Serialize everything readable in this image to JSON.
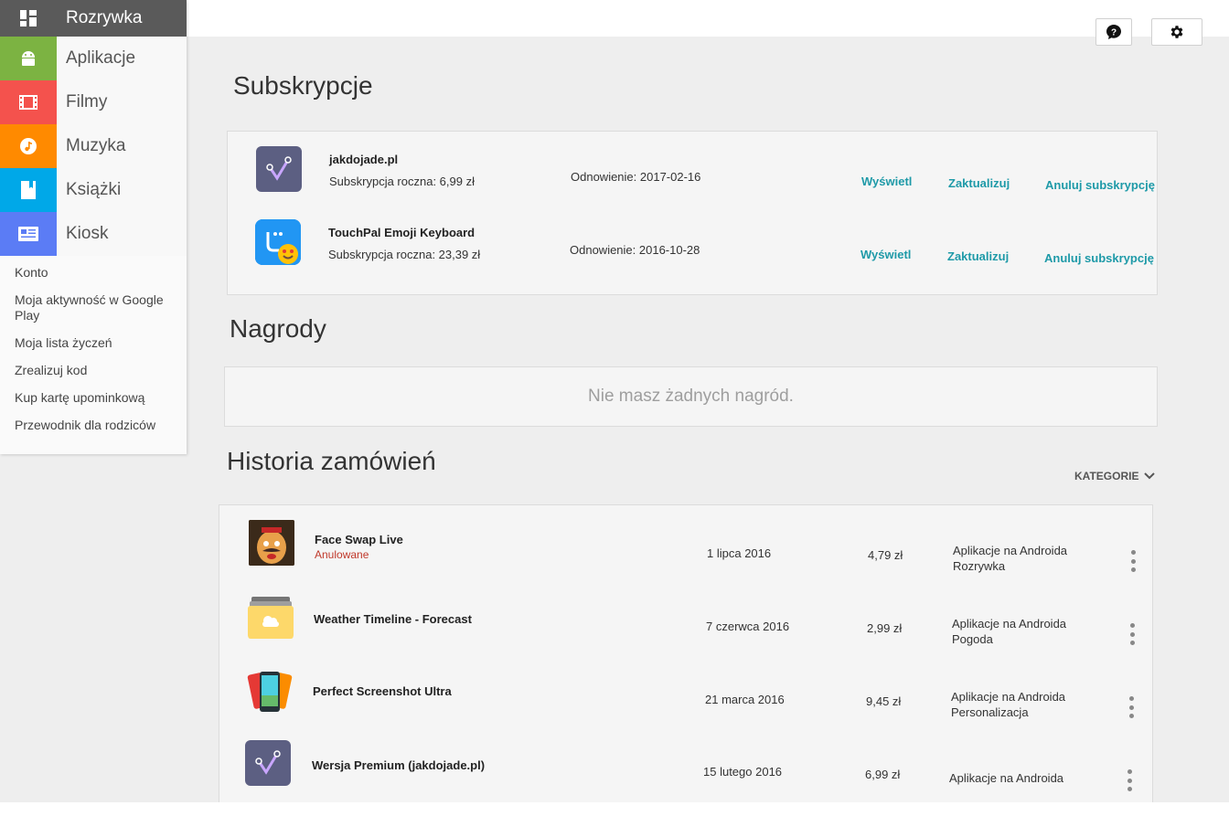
{
  "sidebar": {
    "items": [
      {
        "label": "Rozrywka",
        "color": "#5a5a5a",
        "icon": "grid-icon"
      },
      {
        "label": "Aplikacje",
        "color": "#7cb342",
        "icon": "android-icon"
      },
      {
        "label": "Filmy",
        "color": "#f4524d",
        "icon": "film-icon"
      },
      {
        "label": "Muzyka",
        "color": "#ff8a00",
        "icon": "music-icon"
      },
      {
        "label": "Książki",
        "color": "#00a8e8",
        "icon": "book-icon"
      },
      {
        "label": "Kiosk",
        "color": "#5b7cf5",
        "icon": "newsstand-icon"
      }
    ],
    "links": [
      "Konto",
      "Moja aktywność w Google Play",
      "Moja lista życzeń",
      "Zrealizuj kod",
      "Kup kartę upominkową",
      "Przewodnik dla rodziców"
    ]
  },
  "subscriptions": {
    "heading": "Subskrypcje",
    "rows": [
      {
        "name": "jakdojade.pl",
        "plan": "Subskrypcja roczna: 6,99 zł",
        "renewal": "Odnowienie: 2017-02-16",
        "view": "Wyświetl",
        "update": "Zaktualizuj",
        "cancel": "Anuluj subskrypcję"
      },
      {
        "name": "TouchPal Emoji Keyboard",
        "plan": "Subskrypcja roczna: 23,39 zł",
        "renewal": "Odnowienie: 2016-10-28",
        "view": "Wyświetl",
        "update": "Zaktualizuj",
        "cancel": "Anuluj subskrypcję"
      }
    ]
  },
  "rewards": {
    "heading": "Nagrody",
    "empty": "Nie masz żadnych nagród."
  },
  "orders": {
    "heading": "Historia zamówień",
    "filter": "KATEGORIE",
    "rows": [
      {
        "name": "Face Swap Live",
        "status": "Anulowane",
        "date": "1 lipca 2016",
        "price": "4,79 zł",
        "cat1": "Aplikacje na Androida",
        "cat2": "Rozrywka"
      },
      {
        "name": "Weather Timeline - Forecast",
        "status": "",
        "date": "7 czerwca 2016",
        "price": "2,99 zł",
        "cat1": "Aplikacje na Androida",
        "cat2": "Pogoda"
      },
      {
        "name": "Perfect Screenshot Ultra",
        "status": "",
        "date": "21 marca 2016",
        "price": "9,45 zł",
        "cat1": "Aplikacje na Androida",
        "cat2": "Personalizacja"
      },
      {
        "name": "Wersja Premium (jakdojade.pl)",
        "status": "",
        "date": "15 lutego 2016",
        "price": "6,99 zł",
        "cat1": "Aplikacje na Androida",
        "cat2": ""
      }
    ]
  },
  "colors": {
    "accent": "#1e9aa8",
    "cancelled": "#c0392b"
  }
}
